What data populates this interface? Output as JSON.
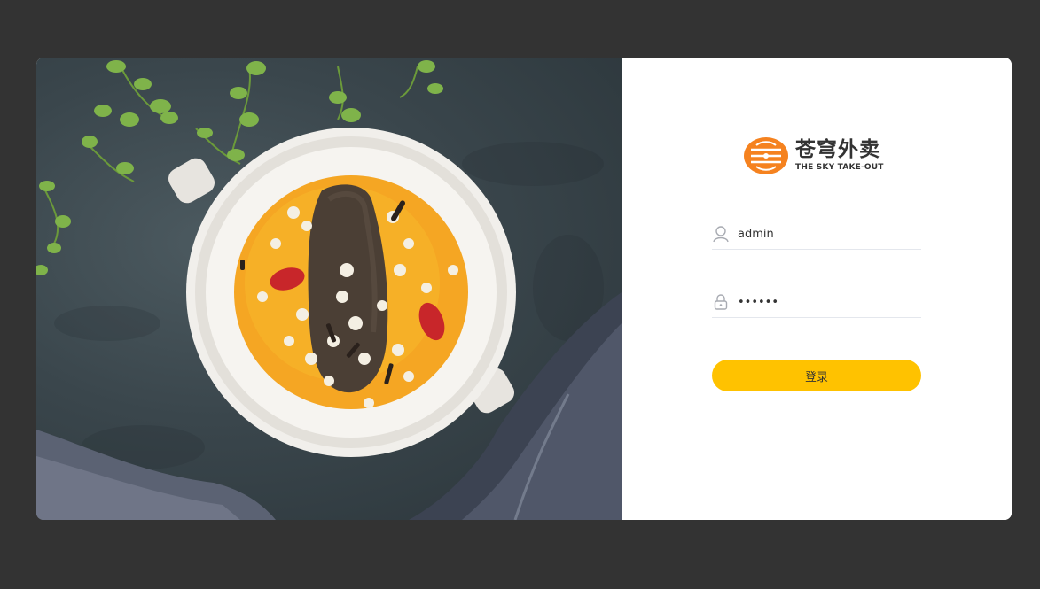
{
  "brand": {
    "name_cn": "苍穹外卖",
    "name_en": "THE SKY TAKE-OUT",
    "logo_color": "#f5821f"
  },
  "login_form": {
    "username_value": "admin",
    "password_value": "123456",
    "submit_label": "登录"
  },
  "colors": {
    "page_background": "#333333",
    "accent": "#ffc200",
    "card_background": "#ffffff"
  },
  "icons": {
    "username": "user-icon",
    "password": "lock-icon"
  }
}
